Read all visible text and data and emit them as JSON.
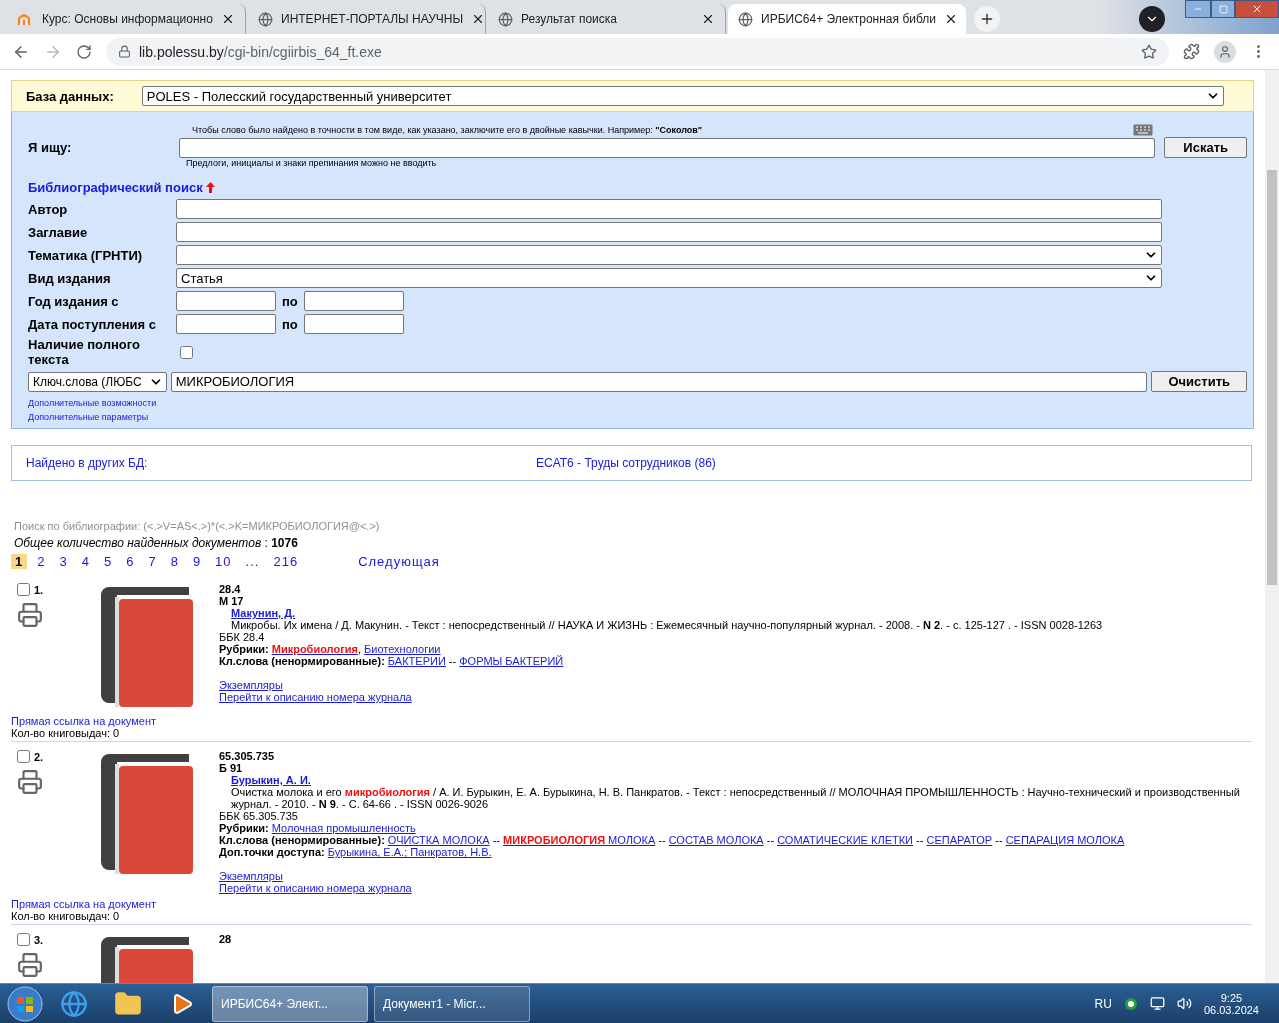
{
  "browser": {
    "tabs": [
      {
        "title": "Курс: Основы информационно",
        "selected": false
      },
      {
        "title": "ИНТЕРНЕТ-ПОРТАЛЫ НАУЧНЫ",
        "selected": false
      },
      {
        "title": "Результат поиска",
        "selected": false
      },
      {
        "title": "ИРБИС64+ Электронная библи",
        "selected": true
      }
    ],
    "address": {
      "host": "lib.polessu.by",
      "path": "/cgi-bin/cgiirbis_64_ft.exe"
    }
  },
  "database": {
    "label": "База данных:",
    "value": "POLES - Полесский государственный университет"
  },
  "search": {
    "hint_top": "Чтобы слово было найдено в точности в том виде, как указано, заключите его в двойные кавычки. Например: **\"Соколов\"**",
    "label": "Я ищу:",
    "hint_bottom": "Предлоги, инициалы и знаки препинания можно не вводить",
    "button": "Искать"
  },
  "biblio": {
    "title": "Библиографический поиск",
    "fields": [
      {
        "kind": "text",
        "label": "Автор"
      },
      {
        "kind": "text",
        "label": "Заглавие"
      },
      {
        "kind": "select",
        "label": "Тематика (ГРНТИ)"
      },
      {
        "kind": "select",
        "label": "Вид издания",
        "value": "Статья"
      },
      {
        "kind": "range",
        "label": "Год издания с",
        "separator": "по"
      },
      {
        "kind": "range",
        "label": "Дата поступления с",
        "separator": "по"
      },
      {
        "kind": "checkbox",
        "label": "Наличие полного текста",
        "checked": false
      }
    ],
    "keyword": {
      "field": "Ключ.слова (ЛЮБС",
      "value": "МИКРОБИОЛОГИЯ",
      "button": "Очистить"
    },
    "links": [
      "Дополнительные возможности",
      "Дополнительные параметры"
    ]
  },
  "other_db": {
    "label": "Найдено в других БД:",
    "link": "ECAT6 - Труды сотрудников (86)"
  },
  "query": "Поиск по библиографии: (<.>V=AS<.>)*(<.>K=МИКРОБИОЛОГИЯ@<.>)",
  "total": "*Общее количество найденных документов* : **1076**",
  "pages": [
    {
      "label": "1",
      "selected": true
    },
    {
      "label": "2",
      "selected": false
    },
    {
      "label": "3",
      "selected": false
    },
    {
      "label": "4",
      "selected": false
    },
    {
      "label": "5",
      "selected": false
    },
    {
      "label": "6",
      "selected": false
    },
    {
      "label": "7",
      "selected": false
    },
    {
      "label": "8",
      "selected": false
    },
    {
      "label": "9",
      "selected": false
    },
    {
      "label": "10",
      "selected": false
    },
    {
      "label": "...",
      "selected": false
    },
    {
      "label": "216",
      "selected": false
    }
  ],
  "next_page": "Следующая",
  "records": [
    {
      "number": "1.",
      "checked": false,
      "index": [
        "28.4",
        "М 17"
      ],
      "author": "Макунин, Д.",
      "description": [
        {
          "text": "Микробы. Их имена / Д. Макунин. - Текст : непосредственный // НАУКА И ЖИЗНЬ : Ежемесячный научно-популярный журнал. - 2008. - ",
          "kind": "plain"
        },
        {
          "text": "N 2",
          "kind": "bold"
        },
        {
          "text": ". - с. 125-127 . - ISSN 0028-1263",
          "kind": "plain"
        }
      ],
      "bbk": "ББК 28.4",
      "rubrics": {
        "label": "Рубрики:",
        "separator": ",",
        "items": [
          {
            "text": "Микробиология",
            "hit": true
          },
          {
            "text": "Биотехнологии",
            "hit": false
          }
        ]
      },
      "keywords": {
        "label": "Кл.слова (ненормированные):",
        "separator": "--",
        "items": [
          [
            {
              "text": "БАКТЕРИИ",
              "hit": false
            }
          ],
          [
            {
              "text": "ФОРМЫ БАКТЕРИЙ",
              "hit": false
            }
          ]
        ]
      },
      "links": [
        "Экземпляры",
        "Перейти к описанию номера журнала"
      ],
      "direct_link": "Прямая ссылка на документ",
      "loans": "Кол-во книговыдач: 0"
    },
    {
      "number": "2.",
      "checked": false,
      "index": [
        "65.305.735",
        "Б 91"
      ],
      "author": "Бурыкин, А. И.",
      "description": [
        {
          "text": "Очистка молока и его ",
          "kind": "plain"
        },
        {
          "text": "микробиология",
          "kind": "hit"
        },
        {
          "text": " / А. И. Бурыкин, Е. А. Бурыкина, Н. В. Панкратов. - Текст : непосредственный // МОЛОЧНАЯ ПРОМЫШЛЕННОСТЬ : Научно-технический и производственный журнал. - 2010. - ",
          "kind": "plain"
        },
        {
          "text": "N 9",
          "kind": "bold"
        },
        {
          "text": ". - С. 64-66 . - ISSN 0026-9026",
          "kind": "plain"
        }
      ],
      "bbk": "ББК 65.305.735",
      "rubrics": {
        "label": "Рубрики:",
        "items": [
          {
            "text": "Молочная промышленность",
            "hit": false
          }
        ]
      },
      "keywords": {
        "label": "Кл.слова (ненормированные):",
        "separator": "--",
        "items": [
          [
            {
              "text": "ОЧИСТКА МОЛОКА",
              "hit": false
            }
          ],
          [
            {
              "text": "МИКРОБИОЛОГИЯ",
              "hit": true
            },
            {
              "text": " МОЛОКА",
              "hit": false
            }
          ],
          [
            {
              "text": "СОСТАВ МОЛОКА",
              "hit": false
            }
          ],
          [
            {
              "text": "СОМАТИЧЕСКИЕ КЛЕТКИ",
              "hit": false
            }
          ],
          [
            {
              "text": "СЕПАРАТОР",
              "hit": false
            }
          ],
          [
            {
              "text": "СЕПАРАЦИЯ МОЛОКА",
              "hit": false
            }
          ]
        ]
      },
      "access": {
        "label": "Доп.точки доступа:",
        "value": "Бурыкина, Е.А.; Панкратов, Н.В."
      },
      "links": [
        "Экземпляры",
        "Перейти к описанию номера журнала"
      ],
      "direct_link": "Прямая ссылка на документ",
      "loans": "Кол-во книговыдач: 0"
    },
    {
      "number": "3.",
      "checked": false,
      "index": [
        "28"
      ]
    }
  ],
  "taskbar": {
    "windows": [
      {
        "title": "ИРБИС64+ Элект...",
        "selected": true
      },
      {
        "title": "Документ1 - Micr...",
        "selected": false
      }
    ],
    "language": "RU",
    "time": "9:25",
    "date": "06.03.2024"
  }
}
